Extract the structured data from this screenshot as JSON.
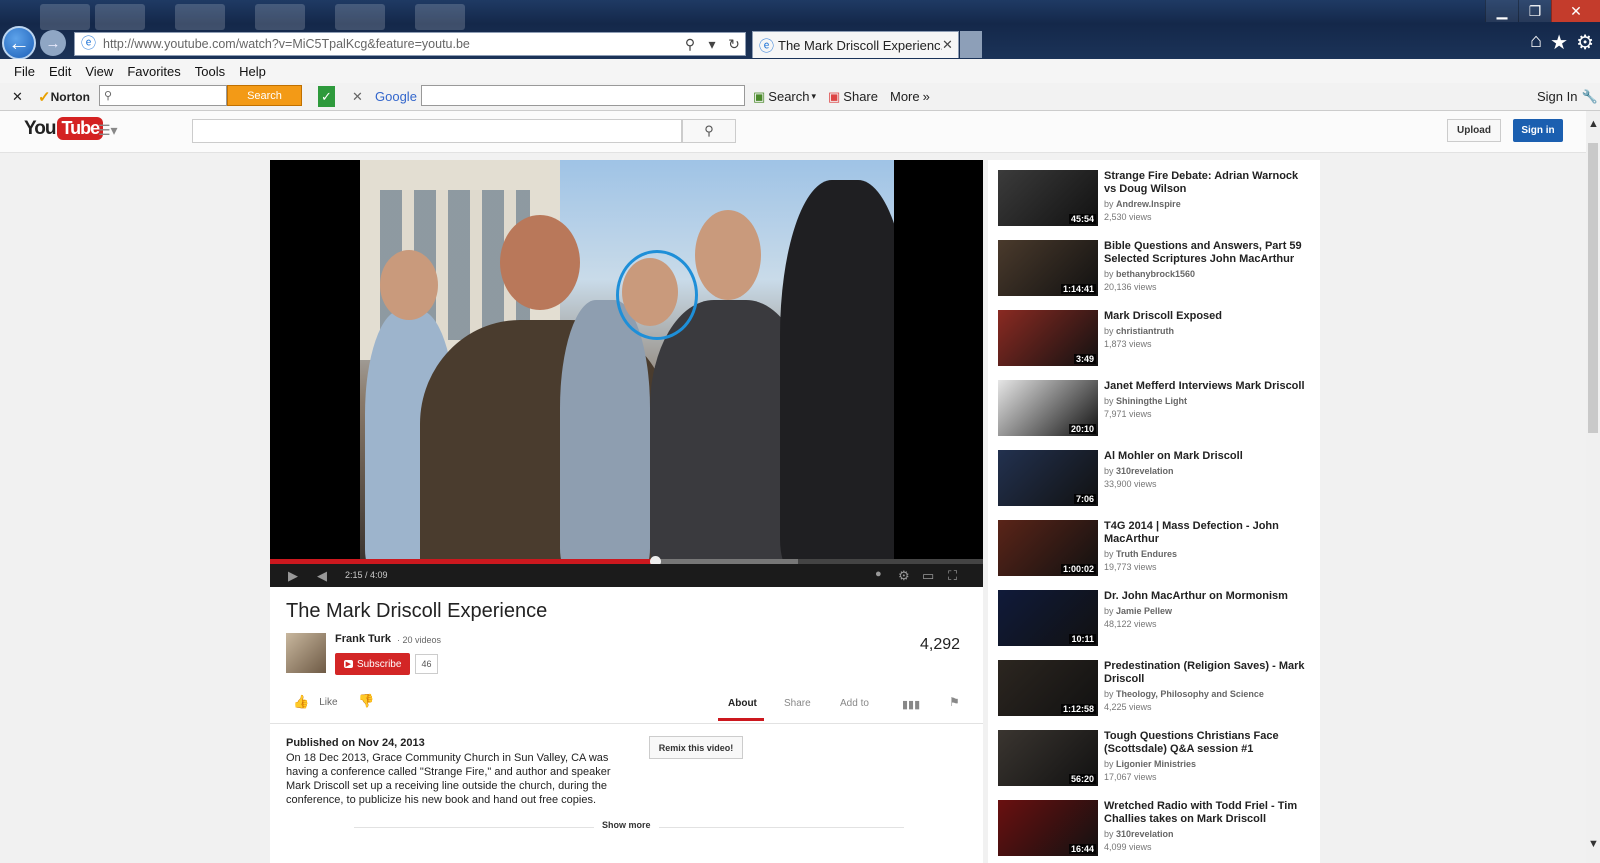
{
  "browser": {
    "url": "http://www.youtube.com/watch?v=MiC5TpalKcg&feature=youtu.be",
    "tab_title": "The Mark Driscoll Experienc...",
    "menu": [
      "File",
      "Edit",
      "View",
      "Favorites",
      "Tools",
      "Help"
    ],
    "toolbar": {
      "norton_label": "Norton",
      "norton_search_button": "Search",
      "google_label": "Google",
      "search_label": "Search",
      "share_label": "Share",
      "more_label": "More",
      "sign_in_label": "Sign In"
    },
    "icons": [
      "back-icon",
      "forward-icon",
      "search-icon",
      "refresh-icon",
      "home-icon",
      "favorites-star-icon",
      "settings-gear-icon"
    ]
  },
  "youtube": {
    "logo_you": "You",
    "logo_tube": "Tube",
    "upload_label": "Upload",
    "signin_label": "Sign in"
  },
  "player": {
    "time_current": "2:15",
    "time_total": "4:09",
    "time_display": "2:15 / 4:09",
    "played_fraction": 0.54,
    "buffered_fraction": 0.74
  },
  "video": {
    "title": "The Mark Driscoll Experience",
    "channel_name": "Frank Turk",
    "channel_videos": "· 20 videos",
    "subscribe_label": "Subscribe",
    "subscriber_count": "46",
    "views": "4,292",
    "like_label": "Like",
    "tabs": [
      "About",
      "Share",
      "Add to"
    ],
    "published": "Published on Nov 24, 2013",
    "description": "On 18 Dec 2013, Grace Community Church in Sun Valley, CA was having a conference called \"Strange Fire,\" and author and speaker Mark Driscoll set up a receiving line outside the church, during the conference, to publicize his new book and hand out free copies.",
    "remix_label": "Remix this video!",
    "show_more_label": "Show more"
  },
  "related": [
    {
      "title": "Strange Fire Debate: Adrian Warnock vs Doug Wilson",
      "by": "Andrew.Inspire",
      "views": "2,530 views",
      "duration": "45:54",
      "thumb_color": "#3b3b3b"
    },
    {
      "title": "Bible Questions and Answers, Part 59 Selected Scriptures John MacArthur",
      "by": "bethanybrock1560",
      "views": "20,136 views",
      "duration": "1:14:41",
      "thumb_color": "#4a3a2c"
    },
    {
      "title": "Mark Driscoll Exposed",
      "by": "christiantruth",
      "views": "1,873 views",
      "duration": "3:49",
      "thumb_color": "#8a2a22"
    },
    {
      "title": "Janet Mefferd Interviews Mark Driscoll",
      "by": "Shiningthe Light",
      "views": "7,971 views",
      "duration": "20:10",
      "thumb_color": "#e6e6e6"
    },
    {
      "title": "Al Mohler on Mark Driscoll",
      "by": "310revelation",
      "views": "33,900 views",
      "duration": "7:06",
      "thumb_color": "#22314f"
    },
    {
      "title": "T4G 2014 | Mass Defection - John MacArthur",
      "by": "Truth Endures",
      "views": "19,773 views",
      "duration": "1:00:02",
      "thumb_color": "#5a2418"
    },
    {
      "title": "Dr. John MacArthur on Mormonism",
      "by": "Jamie Pellew",
      "views": "48,122 views",
      "duration": "10:11",
      "thumb_color": "#101a3a"
    },
    {
      "title": "Predestination (Religion Saves) - Mark Driscoll",
      "by": "Theology, Philosophy and Science",
      "views": "4,225 views",
      "duration": "1:12:58",
      "thumb_color": "#2c2620"
    },
    {
      "title": "Tough Questions Christians Face (Scottsdale) Q&A session #1",
      "by": "Ligonier Ministries",
      "views": "17,067 views",
      "duration": "56:20",
      "thumb_color": "#3a3530"
    },
    {
      "title": "Wretched Radio with Todd Friel - Tim Challies takes on Mark Driscoll",
      "by": "310revelation",
      "views": "4,099 views",
      "duration": "16:44",
      "thumb_color": "#6a1010"
    }
  ]
}
